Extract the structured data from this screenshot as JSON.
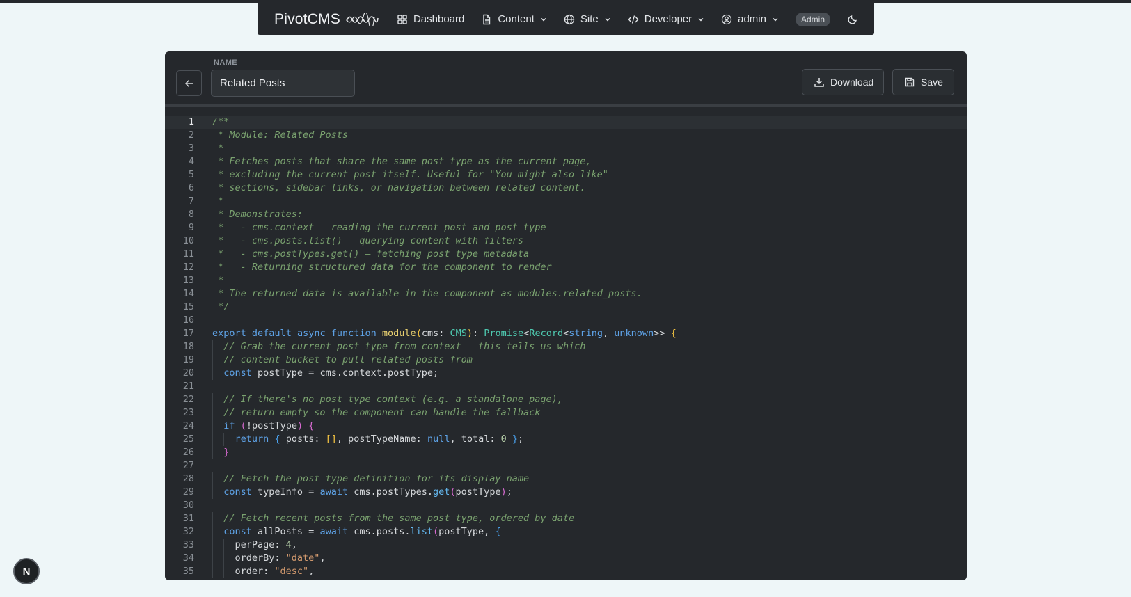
{
  "nav": {
    "brand": "PivotCMS",
    "items": [
      {
        "label": "Dashboard",
        "icon": "grid-icon",
        "dropdown": false
      },
      {
        "label": "Content",
        "icon": "file-icon",
        "dropdown": true
      },
      {
        "label": "Site",
        "icon": "globe-icon",
        "dropdown": true
      },
      {
        "label": "Developer",
        "icon": "code-icon",
        "dropdown": true
      },
      {
        "label": "admin",
        "icon": "user-circle-icon",
        "dropdown": true
      }
    ],
    "role_badge": "Admin",
    "theme_icon": "moon-icon"
  },
  "editor_header": {
    "name_label": "NAME",
    "name_value": "Related Posts",
    "download_label": "Download",
    "save_label": "Save"
  },
  "code": {
    "active_line": 1,
    "lines": [
      "/**",
      " * Module: Related Posts",
      " *",
      " * Fetches posts that share the same post type as the current page,",
      " * excluding the current post itself. Useful for \"You might also like\"",
      " * sections, sidebar links, or navigation between related content.",
      " *",
      " * Demonstrates:",
      " *   - cms.context — reading the current post and post type",
      " *   - cms.posts.list() — querying content with filters",
      " *   - cms.postTypes.get() — fetching post type metadata",
      " *   - Returning structured data for the component to render",
      " *",
      " * The returned data is available in the component as modules.related_posts.",
      " */",
      "",
      "export default async function module(cms: CMS): Promise<Record<string, unknown>> {",
      "  // Grab the current post type from context — this tells us which",
      "  // content bucket to pull related posts from",
      "  const postType = cms.context.postType;",
      "",
      "  // If there's no post type context (e.g. a standalone page),",
      "  // return empty so the component can handle the fallback",
      "  if (!postType) {",
      "    return { posts: [], postTypeName: null, total: 0 };",
      "  }",
      "",
      "  // Fetch the post type definition for its display name",
      "  const typeInfo = await cms.postTypes.get(postType);",
      "",
      "  // Fetch recent posts from the same post type, ordered by date",
      "  const allPosts = await cms.posts.list(postType, {",
      "    perPage: 4,",
      "    orderBy: \"date\",",
      "    order: \"desc\","
    ]
  },
  "floating_button": {
    "icon": "next-logo-icon",
    "letter": "N"
  }
}
